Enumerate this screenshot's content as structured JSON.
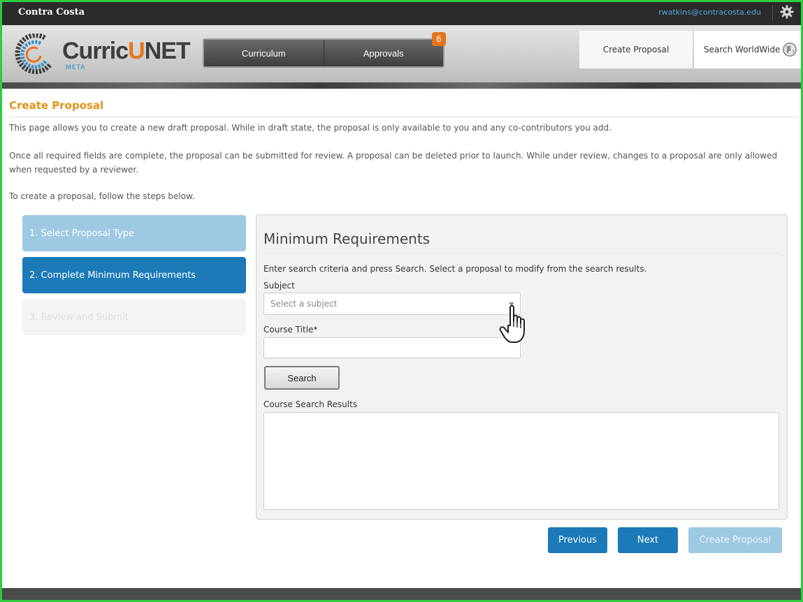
{
  "topbar": {
    "org_name": "Contra Costa",
    "user_email": "rwatkins@contracosta.edu",
    "settings_icon": "gear-icon"
  },
  "logo": {
    "part1": "Curric",
    "part2": "U",
    "part3": "NET",
    "sub": "META"
  },
  "nav": {
    "tabs": [
      {
        "label": "Curriculum"
      },
      {
        "label": "Approvals"
      }
    ],
    "approvals_badge": "6"
  },
  "header_actions": {
    "create_proposal": "Create Proposal",
    "search_worldwide": "Search WorldWide",
    "globe_icon": "globe-icon"
  },
  "page": {
    "title": "Create Proposal",
    "intro1": "This page allows you to create a new draft proposal. While in draft state, the proposal is only available to you and any co-contributors you add.",
    "intro2": "Once all required fields are complete, the proposal can be submitted for review. A proposal can be deleted prior to launch. While under review, changes to a proposal are only allowed when requested by a reviewer.",
    "intro3": "To create a proposal, follow the steps below."
  },
  "steps": [
    {
      "label": "1. Select Proposal Type",
      "state": "completed"
    },
    {
      "label": "2. Complete Minimum Requirements",
      "state": "active"
    },
    {
      "label": "3. Review and Submit",
      "state": "disabled"
    }
  ],
  "form": {
    "heading": "Minimum Requirements",
    "instructions": "Enter search criteria and press Search. Select a proposal to modify from the search results.",
    "subject_label": "Subject",
    "subject_placeholder": "Select a subject",
    "course_title_label": "Course Title*",
    "course_title_value": "",
    "search_button": "Search",
    "results_label": "Course Search Results"
  },
  "footer": {
    "previous": "Previous",
    "next": "Next",
    "create": "Create Proposal"
  },
  "colors": {
    "accent_orange": "#e0931a",
    "primary_blue": "#1c7ab8",
    "light_blue": "#9ec9e3",
    "link_blue": "#57a7d8"
  }
}
